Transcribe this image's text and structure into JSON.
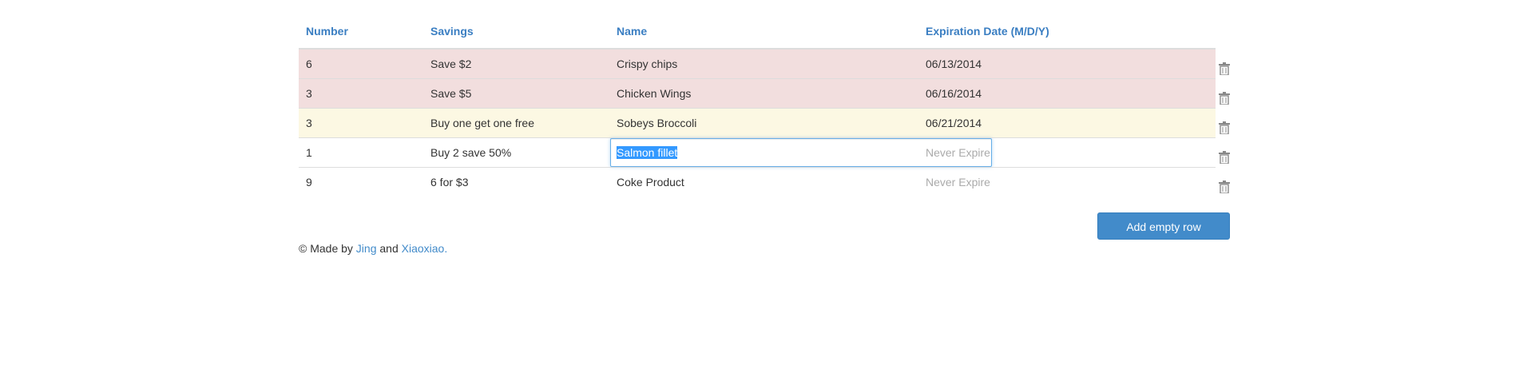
{
  "table": {
    "headers": {
      "number": "Number",
      "savings": "Savings",
      "name": "Name",
      "expiration": "Expiration Date (M/D/Y)"
    },
    "rows": [
      {
        "number": "6",
        "savings": "Save $2",
        "name": "Crispy chips",
        "expiration": "06/13/2014",
        "status": "danger"
      },
      {
        "number": "3",
        "savings": "Save $5",
        "name": "Chicken Wings",
        "expiration": "06/16/2014",
        "status": "danger"
      },
      {
        "number": "3",
        "savings": "Buy one get one free",
        "name": "Sobeys Broccoli",
        "expiration": "06/21/2014",
        "status": "warning"
      },
      {
        "number": "1",
        "savings": "Buy 2 save 50%",
        "name": "Salmon fillet",
        "expiration": "Never Expire",
        "status": "editing"
      },
      {
        "number": "9",
        "savings": "6 for $3",
        "name": "Coke Product",
        "expiration": "Never Expire",
        "status": "normal"
      }
    ]
  },
  "actions": {
    "add_row_label": "Add empty row",
    "delete_icon": "trash-icon"
  },
  "footer": {
    "prefix": "© Made by ",
    "author1": "Jing",
    "conjunction": " and ",
    "author2": "Xiaoxiao",
    "suffix": "."
  },
  "colors": {
    "header_text": "#3a7ec2",
    "danger_row": "#f2dede",
    "warning_row": "#fcf8e3",
    "primary_button": "#428bca",
    "muted_text": "#aaaaaa",
    "selection": "#3399ff"
  }
}
